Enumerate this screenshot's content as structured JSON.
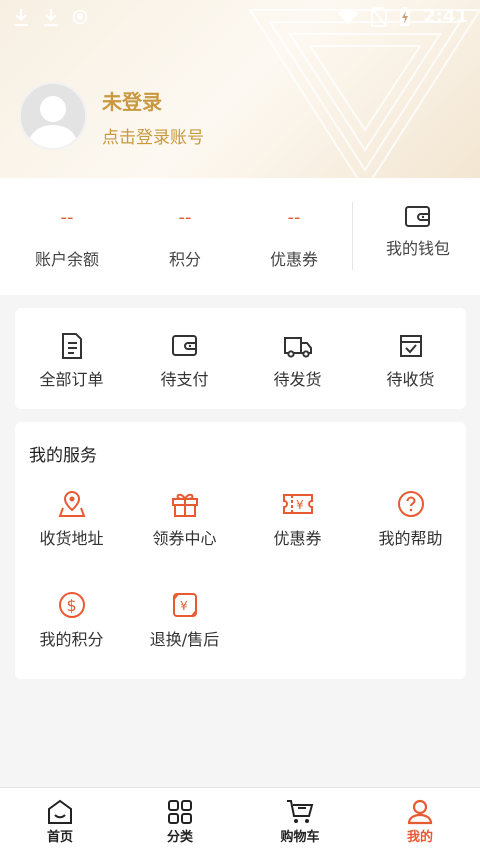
{
  "status_bar": {
    "time": "2:41"
  },
  "header": {
    "login_title": "未登录",
    "login_subtitle": "点击登录账号"
  },
  "stats": {
    "items": [
      {
        "value": "--",
        "label": "账户余额"
      },
      {
        "value": "--",
        "label": "积分"
      },
      {
        "value": "--",
        "label": "优惠券"
      }
    ],
    "wallet_label": "我的钱包"
  },
  "orders": {
    "items": [
      {
        "label": "全部订单",
        "icon": "order-list-icon"
      },
      {
        "label": "待支付",
        "icon": "wallet-icon"
      },
      {
        "label": "待发货",
        "icon": "truck-icon"
      },
      {
        "label": "待收货",
        "icon": "box-check-icon"
      }
    ]
  },
  "services": {
    "title": "我的服务",
    "items": [
      {
        "label": "收货地址",
        "icon": "location-icon"
      },
      {
        "label": "领券中心",
        "icon": "gift-icon"
      },
      {
        "label": "优惠券",
        "icon": "coupon-icon"
      },
      {
        "label": "我的帮助",
        "icon": "help-icon"
      },
      {
        "label": "我的积分",
        "icon": "points-icon"
      },
      {
        "label": "退换/售后",
        "icon": "refund-icon"
      }
    ]
  },
  "tabbar": {
    "items": [
      {
        "label": "首页",
        "icon": "home-icon"
      },
      {
        "label": "分类",
        "icon": "category-icon"
      },
      {
        "label": "购物车",
        "icon": "cart-icon"
      },
      {
        "label": "我的",
        "icon": "user-icon",
        "active": true
      }
    ],
    "active_color": "#e85a32"
  },
  "colors": {
    "accent": "#e85a32",
    "gold": "#c9983f"
  }
}
